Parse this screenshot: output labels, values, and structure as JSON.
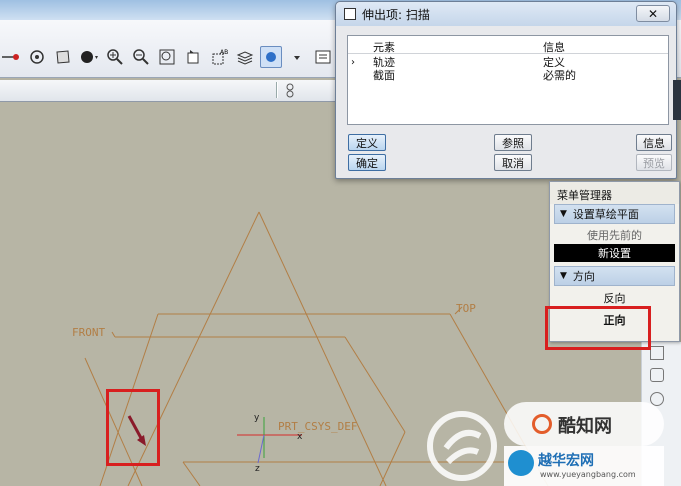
{
  "dialog": {
    "title": "伸出项: 扫描",
    "close_glyph": "✕",
    "col_element": "元素",
    "col_info": "信息",
    "rows": [
      {
        "marker": "›",
        "element": "轨迹",
        "info": "定义"
      },
      {
        "marker": "",
        "element": "截面",
        "info": "必需的"
      }
    ],
    "buttons": {
      "define": "定义",
      "reference": "参照",
      "info": "信息",
      "ok": "确定",
      "cancel": "取消",
      "preview": "预览"
    }
  },
  "menu_manager": {
    "title": "菜单管理器",
    "section_sketch_plane": "设置草绘平面",
    "use_previous": "使用先前的",
    "new_setup": "新设置",
    "section_direction": "方向",
    "flip": "反向",
    "okay": "正向"
  },
  "viewport": {
    "datum_front": "FRONT",
    "datum_top": "TOP",
    "csys_label": "PRT_CSYS_DEF",
    "axis_x": "x",
    "axis_y": "y",
    "axis_z": "z"
  },
  "watermark": {
    "brand": "酷知网",
    "site_name": "越华宏网",
    "site_url": "www.yueyangbang.com"
  },
  "colors": {
    "datum_line": "#b27e45",
    "highlight_box": "#d81f1f",
    "arrow": "#8a1a2a",
    "dialog_title_bar": "#c5d6ea"
  },
  "icons": [
    "sketch-tool-icon",
    "regenerate-icon",
    "layer-icon",
    "shading-icon",
    "zoom-in-icon",
    "zoom-out-icon",
    "refit-icon",
    "view-orient-icon",
    "saved-views-icon",
    "layers-icon",
    "display-style-icon"
  ]
}
